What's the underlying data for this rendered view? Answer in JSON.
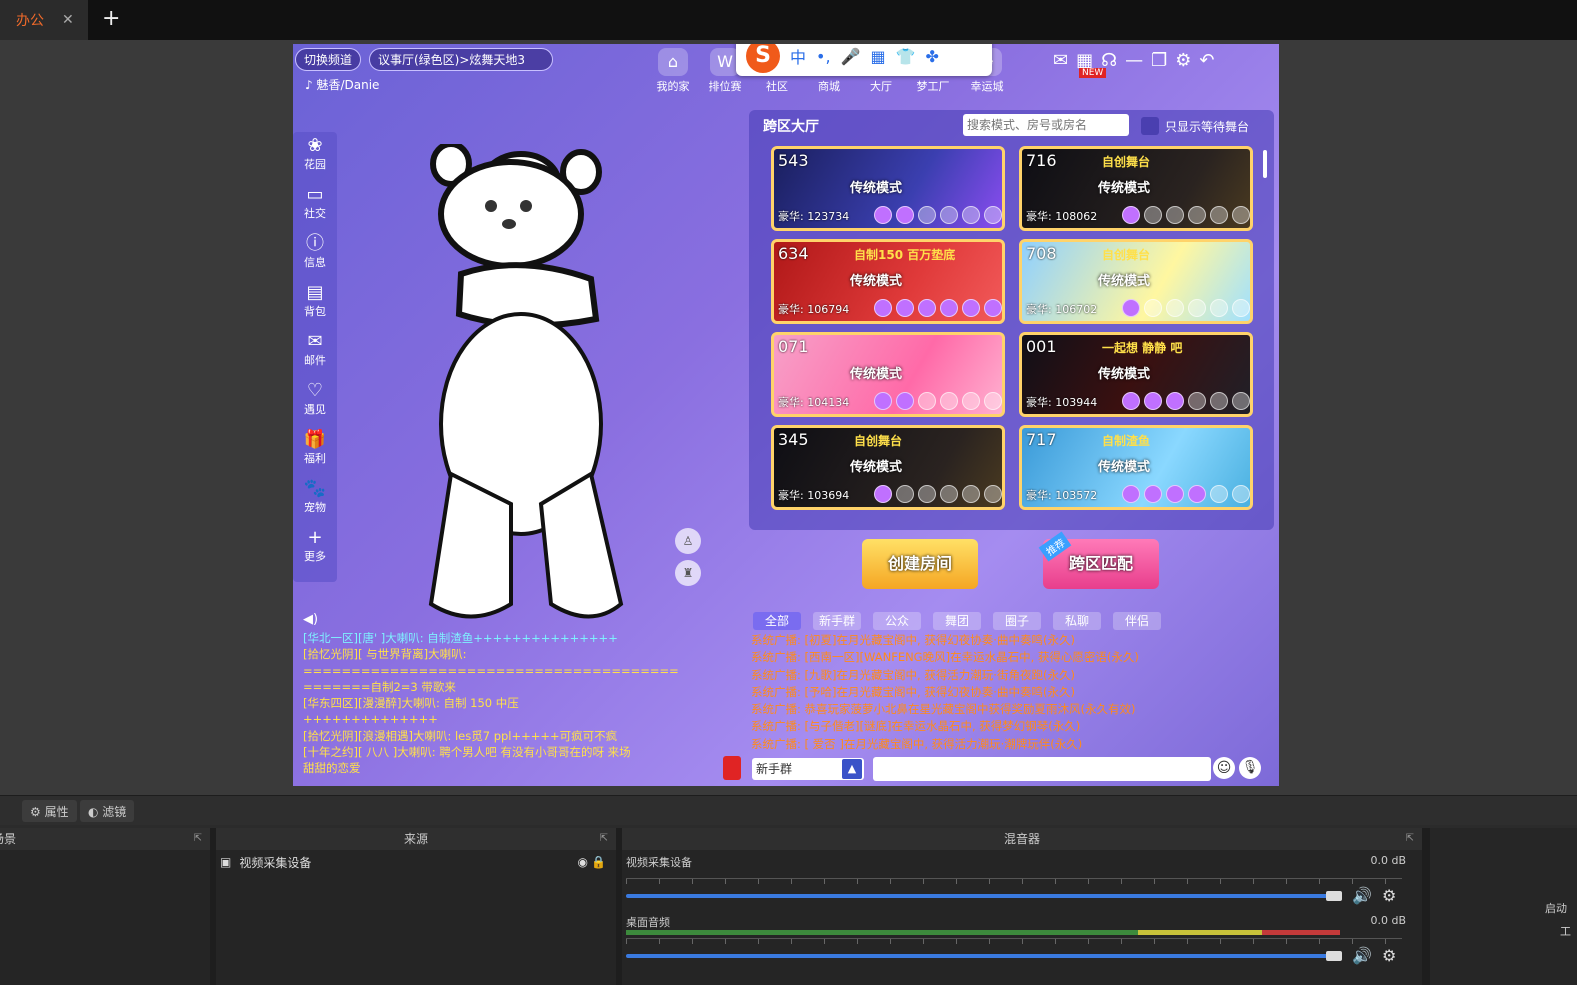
{
  "tabbar": {
    "tab_label": "办公",
    "close": "✕",
    "add": "+"
  },
  "game": {
    "switch_channel": "切换频道",
    "location": "议事厅(绿色区)>炫舞天地3",
    "player_name": "魅香/Danie",
    "topnav": [
      {
        "label": "我的家",
        "icon": "home-icon",
        "glyph": "⌂"
      },
      {
        "label": "排位赛",
        "icon": "win-icon",
        "glyph": "W"
      },
      {
        "label": "社区",
        "icon": "community-icon",
        "glyph": "◉"
      },
      {
        "label": "商城",
        "icon": "shop-icon",
        "glyph": "▣"
      },
      {
        "label": "大厅",
        "icon": "hall-icon",
        "glyph": "◎"
      },
      {
        "label": "梦工厂",
        "icon": "factory-icon",
        "glyph": "✦"
      },
      {
        "label": "幸运城",
        "icon": "lucky-icon",
        "glyph": "☘"
      }
    ],
    "ime": {
      "logo": "S",
      "mode": "中",
      "punct": "•,",
      "mic": "🎤",
      "kbd": "▦",
      "skin": "👕",
      "apps": "✤"
    },
    "window_controls": {
      "new_tag": "NEW",
      "minimize": "—",
      "restore": "❐",
      "settings": "⚙",
      "back": "↶"
    },
    "sidebar": [
      {
        "label": "花园",
        "glyph": "❀",
        "icon": "garden-icon"
      },
      {
        "label": "社交",
        "glyph": "▭",
        "icon": "social-icon"
      },
      {
        "label": "信息",
        "glyph": "ⓘ",
        "icon": "info-icon"
      },
      {
        "label": "背包",
        "glyph": "▤",
        "icon": "bag-icon"
      },
      {
        "label": "邮件",
        "glyph": "✉",
        "icon": "mail-icon"
      },
      {
        "label": "遇见",
        "glyph": "♡",
        "icon": "meet-icon"
      },
      {
        "label": "福利",
        "glyph": "🎁",
        "icon": "gift-icon"
      },
      {
        "label": "宠物",
        "glyph": "🐾",
        "icon": "pet-icon"
      },
      {
        "label": "更多",
        "glyph": "+",
        "icon": "more-icon"
      }
    ],
    "lobby": {
      "title": "跨区大厅",
      "search_placeholder": "搜索模式、房号或房名",
      "wait_only_label": "只显示等待舞台",
      "rooms": [
        {
          "num": "543",
          "name": "",
          "mode": "传统模式",
          "luxury": "豪华: 123734",
          "occupied": 2,
          "bg": "linear-gradient(120deg,#1a1f5e,#3b3fb0 60%,#8a4df0)"
        },
        {
          "num": "716",
          "name": "自创舞台",
          "mode": "传统模式",
          "luxury": "豪华: 108062",
          "occupied": 1,
          "bg": "linear-gradient(120deg,#0e0e14,#2a2320 70%,#4a3a20)"
        },
        {
          "num": "634",
          "name": "自制150  百万垫底",
          "mode": "传统模式",
          "luxury": "豪华: 106794",
          "occupied": 6,
          "bg": "linear-gradient(120deg,#b01818,#e03a3a 60%,#f25a5a)"
        },
        {
          "num": "708",
          "name": "自创舞台",
          "mode": "传统模式",
          "luxury": "豪华: 106702",
          "occupied": 1,
          "bg": "linear-gradient(120deg,#8fd0ff,#fff7a0 60%,#a0e0ff)"
        },
        {
          "num": "071",
          "name": "",
          "mode": "传统模式",
          "luxury": "豪华: 104134",
          "occupied": 2,
          "bg": "linear-gradient(120deg,#f7a0c8,#ff6aa8 60%,#ffb0d0)"
        },
        {
          "num": "001",
          "name": "一起想 静静 吧",
          "mode": "传统模式",
          "luxury": "豪华: 103944",
          "occupied": 3,
          "bg": "linear-gradient(120deg,#101018,#3a1010 50%,#202028)"
        },
        {
          "num": "345",
          "name": "自创舞台",
          "mode": "传统模式",
          "luxury": "豪华: 103694",
          "occupied": 1,
          "bg": "linear-gradient(120deg,#0e0e14,#2a2320 70%,#4a3a20)"
        },
        {
          "num": "717",
          "name": "自制渣鱼",
          "mode": "传统模式",
          "luxury": "豪华: 103572",
          "occupied": 4,
          "bg": "linear-gradient(120deg,#3a9ad8,#8ad8ff 60%,#4ab0e0)"
        }
      ]
    },
    "create_room": "创建房间",
    "cross_match": "跨区匹配",
    "recommend_badge": "推荐",
    "chat_tabs": [
      "全部",
      "新手群",
      "公众",
      "舞团",
      "圈子",
      "私聊",
      "伴侣"
    ],
    "broadcast": [
      "系统广播: [初夏]在月光藏宝阁中, 获得幻夜协奏·曲中奏鸣(永久)",
      "系统广播: [西南一区][WANFENG晚风]在幸运水晶石中, 获得心愿密语(永久)",
      "系统广播: [九歌]在月光藏宝阁中, 获得活力潮玩·街角夜跑(永久)",
      "系统广播: [予哈]在月光藏宝阁中, 获得幻夜协奏·曲中奏鸣(永久)",
      "系统广播: 恭喜玩家菠萝小北鼻在星光藏宝阁中获得奖励夏雨沐风(永久有效)",
      "系统广播: [与子偕老][谜底]在幸运水晶石中, 获得梦幻钢琴(永久)",
      "系统广播: [ 爱否 ]在月光藏宝阁中, 获得活力潮玩·潮牌玩伴(永久)"
    ],
    "left_chat": [
      {
        "text": "[华北一区][唐' ]大喇叭: 自制渣鱼+++++++++++++++",
        "alt": true
      },
      {
        "text": "[拾忆光阴][ 与世界背离]大喇叭:",
        "alt": false
      },
      {
        "text": "=======================================",
        "alt": false
      },
      {
        "text": "=======自制2=3 带歌来",
        "alt": false
      },
      {
        "text": "[华东四区][漫漫醉]大喇叭: 自制  150   中压",
        "alt": false
      },
      {
        "text": "++++++++++++++",
        "alt": false
      },
      {
        "text": "[拾忆光阴][浪漫相遇]大喇叭: les觅7  ppl+++++可疯可不疯",
        "alt": false
      },
      {
        "text": "[十年之约][  八八  ]大喇叭: 聘个男人吧  有没有小哥哥在的呀  来场",
        "alt": false
      },
      {
        "text": "甜甜的恋爱",
        "alt": false
      }
    ],
    "channel": "新手群",
    "emoji": "☺",
    "voice": "🎙"
  },
  "obs": {
    "properties": "属性",
    "filters": "滤镜",
    "scenes_header": "场景",
    "sources_header": "来源",
    "mixer_header": "混音器",
    "source_item": "视频采集设备",
    "mixer": [
      {
        "name": "视频采集设备",
        "db": "0.0 dB",
        "level": 0.0
      },
      {
        "name": "桌面音频",
        "db": "0.0 dB",
        "level": 0.92
      }
    ],
    "right_labels": [
      "启动",
      "工"
    ]
  },
  "colors": {
    "accent": "#f06a2a",
    "game_bg": "#8a6fe0",
    "broadcast": "#ff8a1a",
    "chat": "#ffe04a"
  }
}
